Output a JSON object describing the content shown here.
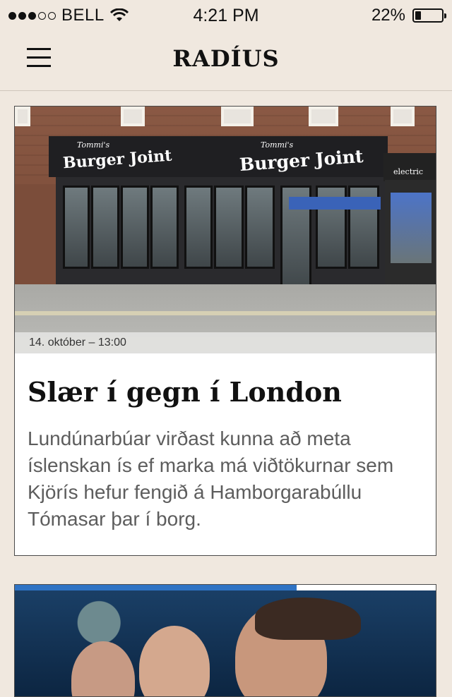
{
  "status_bar": {
    "carrier": "BELL",
    "time": "4:21 PM",
    "battery_percent": "22%",
    "battery_level": 0.22,
    "signal_bars_filled": 3,
    "signal_bars_total": 5
  },
  "nav": {
    "title": "RADÍUS",
    "menu_icon": "hamburger-icon"
  },
  "articles": [
    {
      "image_sign": "Burger Joint",
      "image_sign_small": "Tommi's",
      "image_side_sign": "electric",
      "date": "14. október – 13:00",
      "title": "Slær í gegn í London",
      "summary": "Lundúnarbúar virðast kunna að meta íslenskan ís ef marka má viðtökurnar sem Kjörís hefur fengið á Hamborgarabúllu Tómasar þar í borg."
    },
    {
      "progress": 0.67
    }
  ],
  "colors": {
    "background": "#f0e8df",
    "accent": "#2f73c4",
    "summary_text": "#5d5d5d"
  }
}
